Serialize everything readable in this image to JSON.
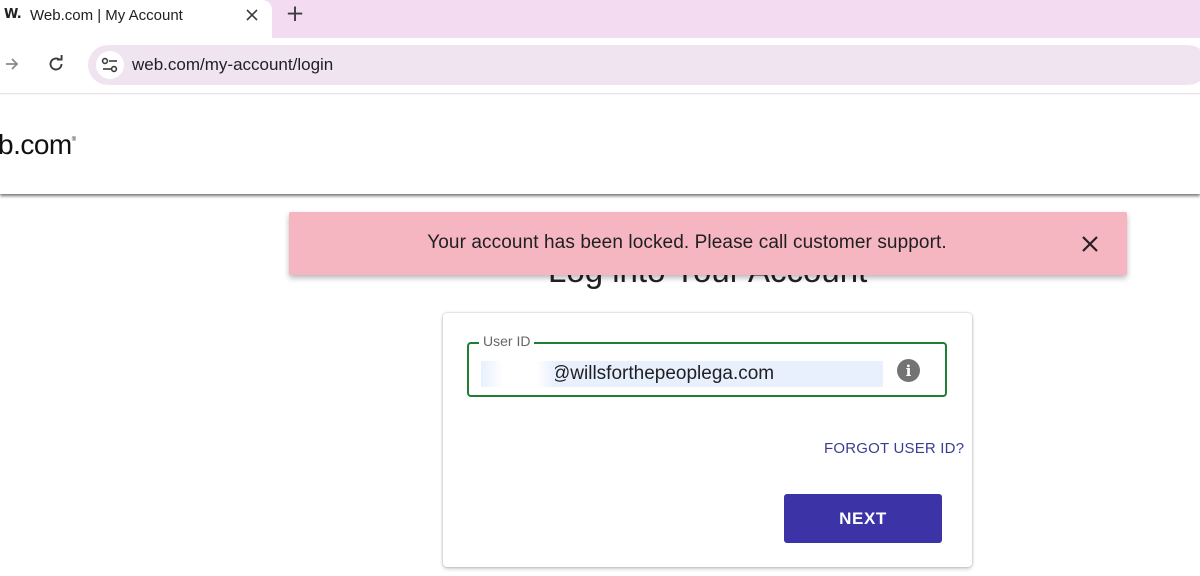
{
  "browser": {
    "tab": {
      "favicon": "W.",
      "title": "Web.com | My Account",
      "close_icon": "close-icon"
    },
    "new_tab_label": "+",
    "toolbar": {
      "forward_icon": "arrow-forward-icon",
      "reload_icon": "reload-icon",
      "site_settings_icon": "tune-icon",
      "url": "web.com/my-account/login"
    }
  },
  "site": {
    "logo_text": "b.com",
    "logo_mark": "®"
  },
  "page": {
    "title": "Log into Your Account"
  },
  "toast": {
    "message": "Your account has been locked. Please call customer support.",
    "background_color": "#f5b5c1"
  },
  "form": {
    "user_id": {
      "label": "User ID",
      "value": "@willsforthepeoplega.com",
      "border_color": "#1e7e34"
    },
    "info_icon": "i",
    "forgot_link": "FORGOT USER ID?",
    "next_button": "NEXT",
    "accent_color": "#3b33a6"
  }
}
